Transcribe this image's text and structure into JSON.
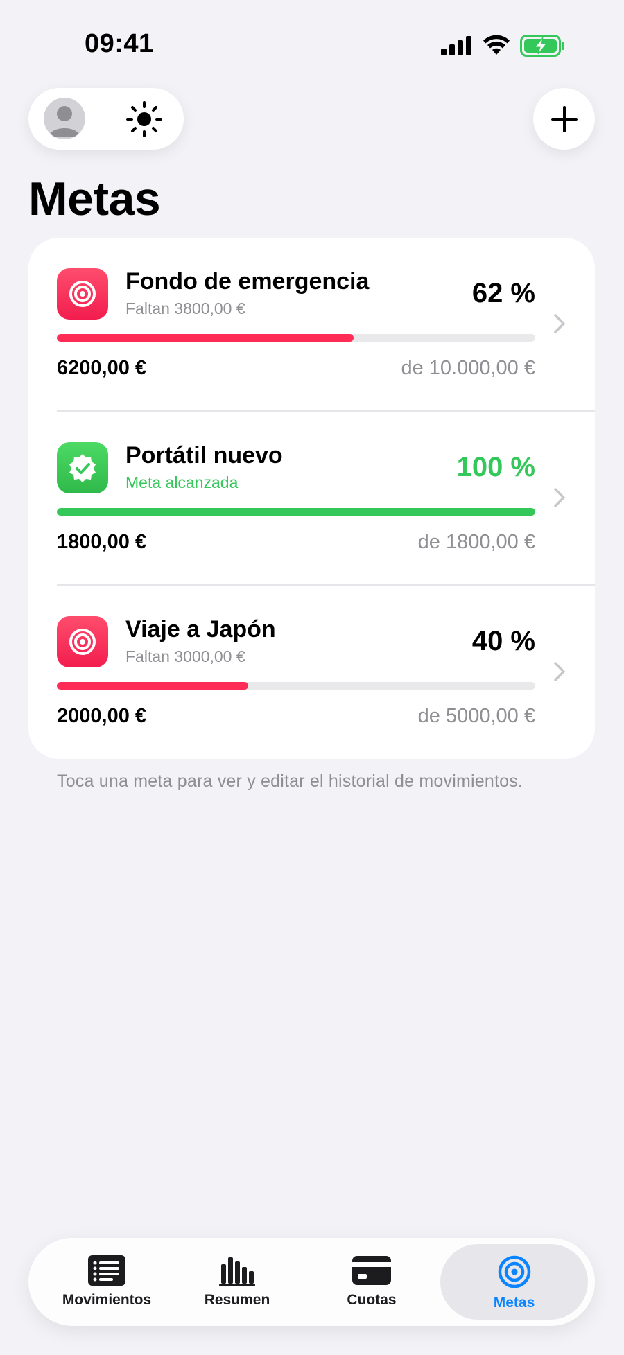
{
  "status": {
    "time": "09:41"
  },
  "page": {
    "title": "Metas"
  },
  "goals": [
    {
      "name": "Fondo de emergencia",
      "subtitle": "Faltan 3800,00 €",
      "percent_label": "62 %",
      "progress": 0.62,
      "saved": "6200,00 €",
      "target": "de 10.000,00 €",
      "icon": "target-icon",
      "color": "#FF2D55",
      "completed": false
    },
    {
      "name": "Portátil nuevo",
      "subtitle": "Meta alcanzada",
      "percent_label": "100 %",
      "progress": 1.0,
      "saved": "1800,00 €",
      "target": "de 1800,00 €",
      "icon": "checkmark-seal-icon",
      "color": "#34C759",
      "completed": true
    },
    {
      "name": "Viaje a Japón",
      "subtitle": "Faltan 3000,00 €",
      "percent_label": "40 %",
      "progress": 0.4,
      "saved": "2000,00 €",
      "target": "de 5000,00 €",
      "icon": "target-icon",
      "color": "#FF2D55",
      "completed": false
    }
  ],
  "hint": "Toca una meta para ver y editar el historial de movimientos.",
  "tabs": [
    {
      "label": "Movimientos",
      "icon": "list-icon",
      "active": false
    },
    {
      "label": "Resumen",
      "icon": "bar-chart-icon",
      "active": false
    },
    {
      "label": "Cuotas",
      "icon": "credit-card-icon",
      "active": false
    },
    {
      "label": "Metas",
      "icon": "target-icon",
      "active": true
    }
  ],
  "colors": {
    "accent": "#0A84FF",
    "danger": "#FF2D55",
    "success": "#34C759",
    "background": "#F2F2F7"
  }
}
